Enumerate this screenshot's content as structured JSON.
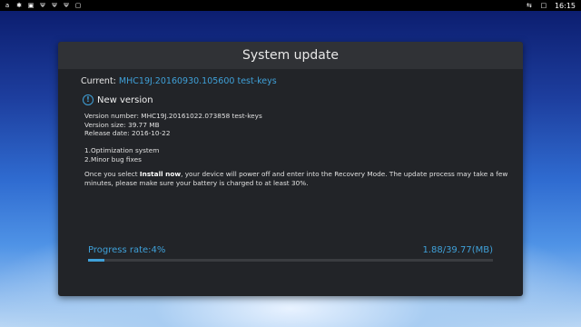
{
  "statusbar": {
    "icons": [
      "amazon-icon",
      "settings-icon",
      "picture-icon",
      "usb-icon",
      "usb-icon",
      "usb-icon",
      "image-icon"
    ],
    "right_icons": [
      "cast-icon",
      "box-icon"
    ],
    "time": "16:15"
  },
  "dialog": {
    "title": "System update",
    "current_label": "Current:",
    "current_value": "MHC19J.20160930.105600 test-keys",
    "new_version_label": "New version",
    "version_number": "Version number: MHC19J.20161022.073858 test-keys",
    "version_size": "Version size: 39.77 MB",
    "release_date": "Release date: 2016-10-22",
    "changes": [
      "1.Optimization system",
      "2.Minor bug fixes"
    ],
    "notice_prefix": "Once you select ",
    "notice_bold": "Install now",
    "notice_suffix": ", your device will power off and enter into the Recovery Mode. The update process may take a few minutes, please make sure your battery is charged to at least 30%.",
    "progress_label": "Progress rate:4%",
    "progress_size": "1.88/39.77(MB)",
    "progress_fraction": 0.04,
    "accent_color": "#3fa0d8"
  }
}
